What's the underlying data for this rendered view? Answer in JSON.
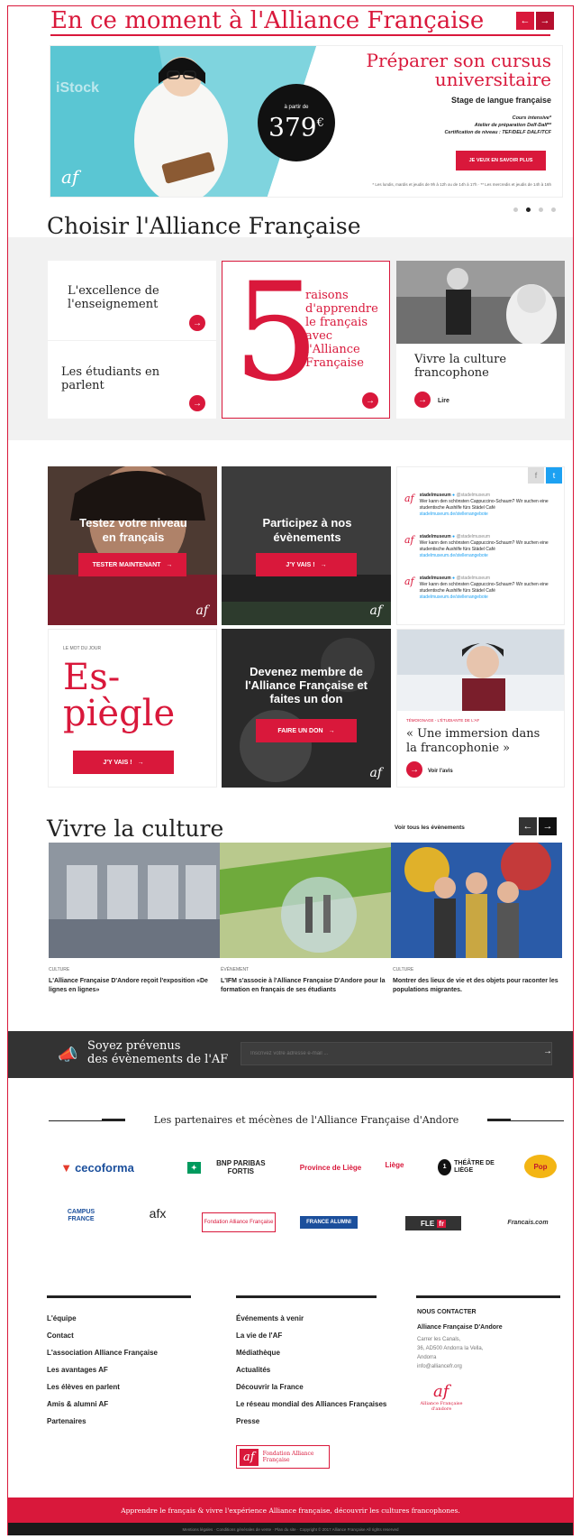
{
  "header": {
    "title": "En ce moment à l'Alliance Française"
  },
  "hero": {
    "price_prefix": "à partir de",
    "price": "379",
    "currency": "€",
    "title_line1": "Préparer son cursus",
    "title_line2": "universitaire",
    "subtitle": "Stage de langue française",
    "detail1": "Cours intensive*",
    "detail2": "Atelier de préparation Delf-Dalf**",
    "detail3": "Certification de niveau : TEF/DELF DALF/TCF",
    "cta": "JE VEUX EN SAVOIR PLUS",
    "footnote": "* Les lundis, mardis et jeudis de 9h à 12h ou de 14h à 17h  · ** Les mercredis et jeudis de 14h à 16h",
    "watermark": "iStock"
  },
  "choisir": {
    "title": "Choisir l'Alliance Française",
    "card1": "L'excellence de l'enseignement",
    "card2": "Les étudiants en parlent",
    "big_number": "5",
    "card3": "raisons d'apprendre le français avec l'Alliance Française",
    "card4": "Vivre la culture francophone",
    "card4_link": "Lire"
  },
  "tiles": {
    "test_title": "Testez votre niveau en français",
    "test_btn": "TESTER MAINTENANT",
    "events_title": "Participez à nos évènements",
    "events_btn": "J'Y VAIS !",
    "tweets": [
      {
        "user": "stadelmuseum",
        "handle": "@stadelmuseum",
        "text": "Wer kann den schönsten Cappuccino-Schaum? Wir suchen eine studentische Aushilfe fürs Städel Café",
        "link": "stadelmuseum.de/stellenangebote"
      },
      {
        "user": "stadelmuseum",
        "handle": "@stadelmuseum",
        "text": "Wer kann den schönsten Cappuccino-Schaum? Wir suchen eine studentische Aushilfe fürs Städel Café",
        "link": "stadelmuseum.de/stellenangebote"
      },
      {
        "user": "stadelmuseum",
        "handle": "@stadelmuseum",
        "text": "Wer kann den schönsten Cappuccino-Schaum? Wir suchen eine studentische Aushilfe fürs Städel Café",
        "link": "stadelmuseum.de/stellenangebote"
      }
    ],
    "word_label": "LE MOT DU JOUR",
    "word_line1": "Es-",
    "word_line2": "piègle",
    "word_btn": "J'Y VAIS !",
    "member_title": "Devenez membre de l'Alliance Française et faites un don",
    "member_btn": "FAIRE UN DON",
    "testimony_label": "TÉMOIGNAGE - L'ÉTUDIANTE DE L'AF",
    "testimony_quote": "« Une immersion dans la francophonie »",
    "testimony_link": "Voir l'avis"
  },
  "culture": {
    "title": "Vivre la culture",
    "all_events": "Voir tous les évènements",
    "items": [
      {
        "tag": "CULTURE",
        "text": "L'Alliance Française D'Andore reçoit l'exposition «De lignes en lignes»"
      },
      {
        "tag": "ÉVÉNEMENT",
        "text": "L'IFM s'associe à l'Alliance Française D'Andore pour la formation en français de ses étudiants"
      },
      {
        "tag": "CULTURE",
        "text": "Montrer des lieux de vie et des objets pour raconter les populations migrantes."
      }
    ]
  },
  "newsletter": {
    "line1": "Soyez prévenus",
    "line2": "des évènements de l'AF",
    "placeholder": "Inscrivez votre adresse e-mail ..."
  },
  "partners": {
    "title": "Les partenaires et mécènes de l'Alliance Française d'Andore",
    "row1": [
      "cecoforma",
      "BNP PARIBAS FORTIS",
      "Province de Liège",
      "Liège",
      "THÉÂTRE DE LIÈGE",
      "Pop"
    ],
    "row2": [
      "CAMPUS FRANCE",
      "afx",
      "Fondation Alliance Française",
      "FRANCE ALUMNI",
      "FLE",
      "Francais.com"
    ]
  },
  "footer": {
    "col1": [
      "L'équipe",
      "Contact",
      "L'association Alliance Française",
      "Les avantages AF",
      "Les élèves en parlent",
      "Amis & alumni AF",
      "Partenaires"
    ],
    "col2": [
      "Événements à venir",
      "La vie de l'AF",
      "Médiathèque",
      "Actualités",
      "Découvrir la France",
      "Le réseau mondial des Alliances Françaises",
      "Presse"
    ],
    "contact_title": "NOUS CONTACTER",
    "contact_name": "Alliance Française D'Andore",
    "contact_addr1": "Carrer les Canals,",
    "contact_addr2": "36, AD500 Andorra la Vella,",
    "contact_addr3": "Andorra",
    "contact_email": "info@alliancefr.org",
    "logo_small": "Alliance Française d'andore",
    "tagline": "Apprendre le français & vivre l'expérience Alliance française, découvrir les cultures francophones.",
    "legal": "Mentions légales · Conditions générales de vente · Plan du site · Copyright © 2017 Alliance Française All rights reserved"
  },
  "colors": {
    "accent": "#d9183b",
    "dark": "#333333",
    "light_bg": "#f1f1f1"
  }
}
